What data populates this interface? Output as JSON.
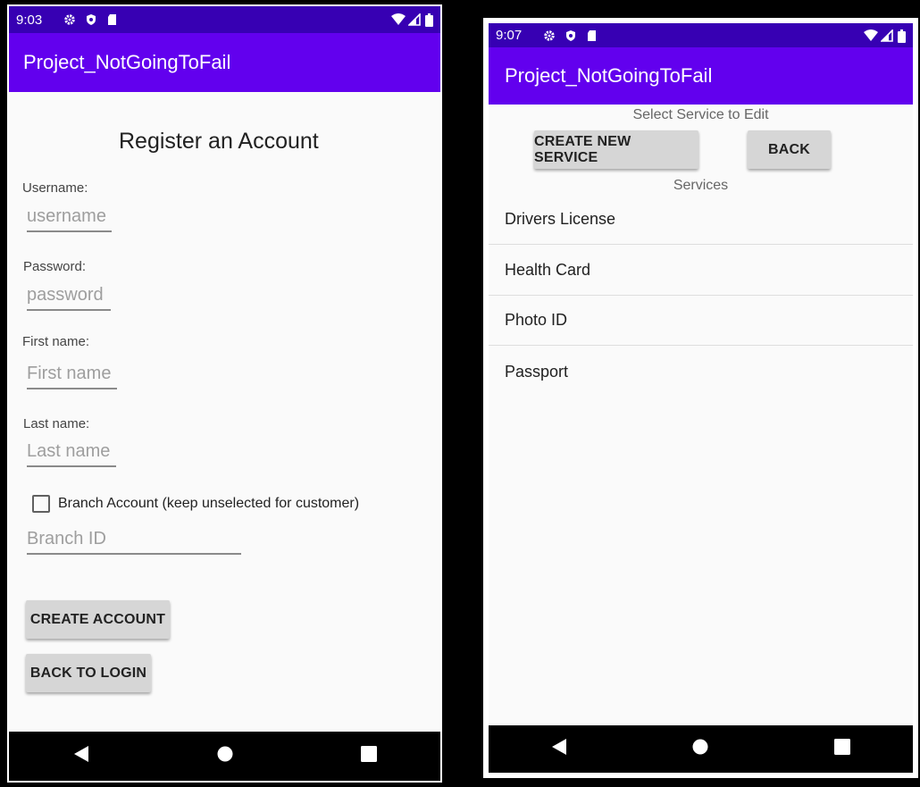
{
  "colors": {
    "status_bar": "#3700b3",
    "app_bar": "#6200ee",
    "nav_bar": "#000000",
    "button_bg": "#d6d6d6",
    "background": "#fafafa"
  },
  "register_screen": {
    "status": {
      "time": "9:03",
      "icons": [
        "gear-icon",
        "shield-icon",
        "sd-card-icon",
        "wifi-icon",
        "signal-icon",
        "battery-icon"
      ]
    },
    "app_title": "Project_NotGoingToFail",
    "heading": "Register an Account",
    "username": {
      "label": "Username:",
      "placeholder": "username"
    },
    "password": {
      "label": "Password:",
      "placeholder": "password"
    },
    "first_name": {
      "label": "First name:",
      "placeholder": "First name"
    },
    "last_name": {
      "label": "Last name:",
      "placeholder": "Last name"
    },
    "branch_checkbox": {
      "label": "Branch Account (keep unselected for customer)",
      "checked": false
    },
    "branch_id": {
      "placeholder": "Branch ID"
    },
    "create_account_label": "CREATE ACCOUNT",
    "back_to_login_label": "BACK TO LOGIN",
    "nav": [
      "back-icon",
      "home-icon",
      "recents-icon"
    ]
  },
  "services_screen": {
    "status": {
      "time": "9:07",
      "icons": [
        "gear-icon",
        "shield-icon",
        "sd-card-icon",
        "wifi-icon",
        "signal-icon",
        "battery-icon"
      ]
    },
    "app_title": "Project_NotGoingToFail",
    "select_label": "Select Service to Edit",
    "create_new_service_label": "CREATE NEW SERVICE",
    "back_label": "BACK",
    "services_label": "Services",
    "services": [
      "Drivers License",
      "Health Card",
      "Photo ID",
      "Passport"
    ],
    "nav": [
      "back-icon",
      "home-icon",
      "recents-icon"
    ]
  }
}
